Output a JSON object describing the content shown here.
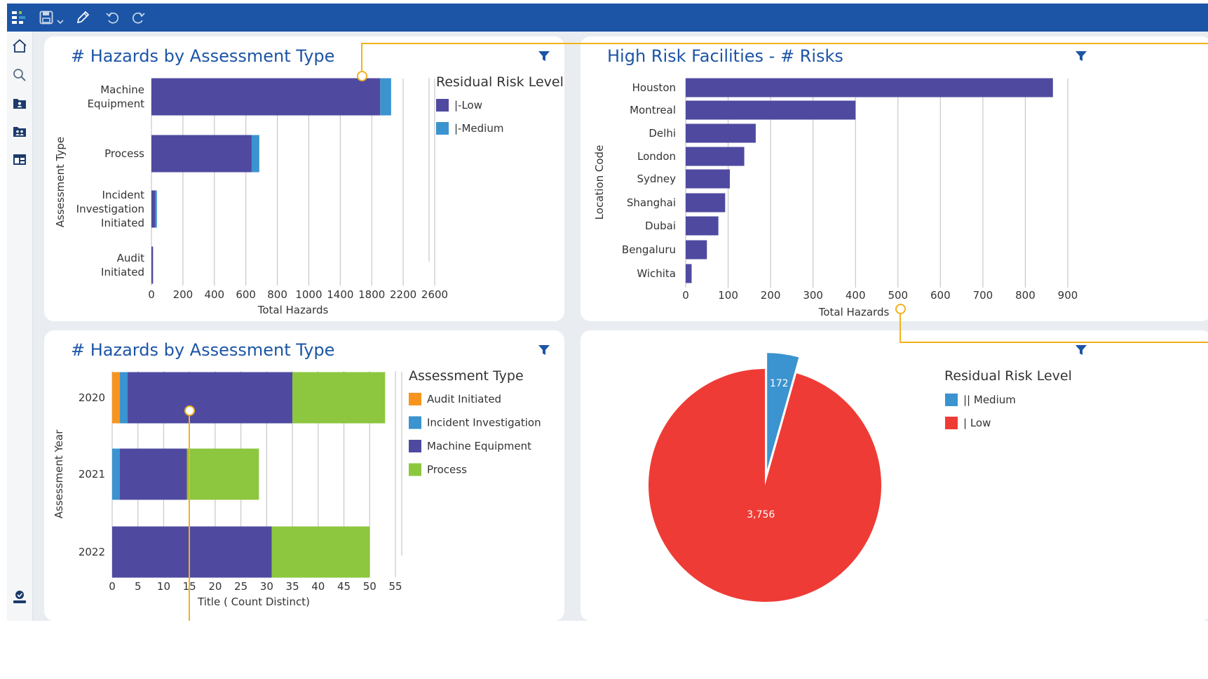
{
  "toolbar": {
    "icons": [
      "app-grid-icon",
      "save-icon",
      "dropdown-caret-icon",
      "edit-pencil-icon",
      "undo-icon",
      "redo-icon"
    ]
  },
  "sidebar": {
    "icons": [
      "home-icon",
      "search-icon",
      "user-folder-icon",
      "team-folder-icon",
      "dashboard-layout-icon",
      "user-profile-icon"
    ]
  },
  "panels": {
    "tl": {
      "title": "# Hazards by Assessment Type"
    },
    "tr": {
      "title": "High Risk Facilities - # Risks"
    },
    "bl": {
      "title": "# Hazards by Assessment Type"
    },
    "br": {
      "title": ""
    }
  },
  "chart_data": [
    {
      "type": "bar",
      "orientation": "horizontal",
      "stacked": true,
      "title": "# Hazards by Assessment Type",
      "xlabel": "Total Hazards",
      "ylabel": "Assessment Type",
      "xlim": [
        0,
        2600
      ],
      "xticks": [
        "0",
        "200",
        "400",
        "600",
        "800",
        "1000",
        "1400",
        "1800",
        "2200",
        "2600"
      ],
      "categories": [
        [
          "Machine",
          "Equipment"
        ],
        [
          "Process"
        ],
        [
          "Incident",
          "Investigation",
          "Initiated"
        ],
        [
          "Audit",
          "Initiated"
        ]
      ],
      "series": [
        {
          "name": "|-Low",
          "color": "#4f4aa0",
          "values": [
            2100,
            920,
            35,
            15
          ]
        },
        {
          "name": "|-Medium",
          "color": "#3b93cf",
          "values": [
            100,
            70,
            15,
            0
          ]
        }
      ],
      "legend_title": "Residual Risk Level",
      "legend_position": "right",
      "grid": true
    },
    {
      "type": "bar",
      "orientation": "horizontal",
      "title": "High Risk Facilities - # Risks",
      "xlabel": "Total Hazards",
      "ylabel": "Location Code",
      "xlim": [
        0,
        900
      ],
      "xticks": [
        "0",
        "100",
        "200",
        "300",
        "400",
        "500",
        "600",
        "700",
        "800",
        "900"
      ],
      "categories": [
        "Houston",
        "Montreal",
        "Delhi",
        "London",
        "Sydney",
        "Shanghai",
        "Dubai",
        "Bengaluru",
        "Wichita"
      ],
      "series": [
        {
          "color": "#4f4aa0",
          "values": [
            865,
            400,
            165,
            138,
            104,
            93,
            77,
            50,
            14
          ]
        }
      ],
      "grid": true
    },
    {
      "type": "bar",
      "orientation": "horizontal",
      "stacked": true,
      "title": "# Hazards by Assessment Type",
      "xlabel": "Title ( Count Distinct)",
      "ylabel": "Assessment Year",
      "xlim": [
        0,
        55
      ],
      "xticks": [
        "0",
        "5",
        "10",
        "15",
        "20",
        "25",
        "30",
        "35",
        "40",
        "45",
        "50",
        "55"
      ],
      "categories": [
        "2020",
        "2021",
        "2022"
      ],
      "series": [
        {
          "name": "Audit Initiated",
          "color": "#f7941d",
          "values": [
            1.5,
            0,
            0
          ]
        },
        {
          "name": "Incident Investigation",
          "color": "#3b93cf",
          "values": [
            1.5,
            1.5,
            0
          ]
        },
        {
          "name": "Machine Equipment",
          "color": "#4f4aa0",
          "values": [
            32,
            13,
            31
          ]
        },
        {
          "name": "Process",
          "color": "#8dc63f",
          "values": [
            18,
            14,
            19
          ]
        }
      ],
      "legend_title": "Assessment Type",
      "legend_position": "right",
      "grid": true
    },
    {
      "type": "pie",
      "legend_title": "Residual Risk Level",
      "legend_position": "right",
      "slices": [
        {
          "name": "|| Medium",
          "value": 172,
          "label": "172",
          "color": "#3b93cf",
          "exploded": true
        },
        {
          "name": "| Low",
          "value": 3756,
          "label": "3,756",
          "color": "#ef3b36"
        }
      ]
    }
  ]
}
